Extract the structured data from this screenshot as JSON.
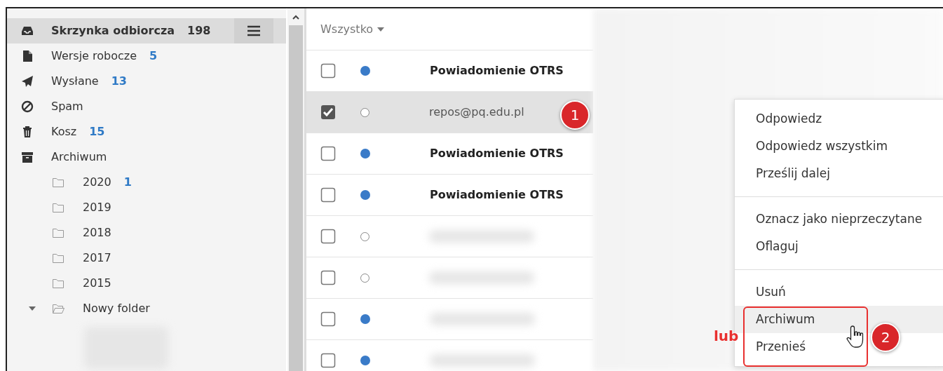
{
  "sidebar": {
    "folders": [
      {
        "kind": "inbox",
        "label": "Skrzynka odbiorcza",
        "count": "198",
        "selected": true
      },
      {
        "kind": "file",
        "label": "Wersje robocze",
        "count": "5",
        "selected": false
      },
      {
        "kind": "plane",
        "label": "Wysłane",
        "count": "13",
        "selected": false
      },
      {
        "kind": "ban",
        "label": "Spam",
        "selected": false
      },
      {
        "kind": "trash",
        "label": "Kosz",
        "count": "15",
        "selected": false
      },
      {
        "kind": "archive",
        "label": "Archiwum",
        "selected": false,
        "children": [
          {
            "kind": "folder",
            "label": "2020",
            "count": "1",
            "selected": false
          },
          {
            "kind": "folder",
            "label": "2019",
            "selected": false
          },
          {
            "kind": "folder",
            "label": "2018",
            "selected": false
          },
          {
            "kind": "folder",
            "label": "2017",
            "selected": false
          },
          {
            "kind": "folder",
            "label": "2015",
            "selected": false
          },
          {
            "kind": "folder-open",
            "label": "Nowy folder",
            "selected": false,
            "expanded": true
          }
        ]
      }
    ]
  },
  "message_list": {
    "filter": "Wszystko",
    "rows": [
      {
        "checked": false,
        "unread": true,
        "sender": "Powiadomienie OTRS"
      },
      {
        "checked": true,
        "unread": false,
        "sender": "repos@pq.edu.pl"
      },
      {
        "checked": false,
        "unread": true,
        "sender": "Powiadomienie OTRS"
      },
      {
        "checked": false,
        "unread": true,
        "sender": "Powiadomienie OTRS"
      },
      {
        "checked": false,
        "unread": false
      },
      {
        "checked": false,
        "unread": false
      },
      {
        "checked": false,
        "unread": true
      },
      {
        "checked": false,
        "unread": true
      }
    ]
  },
  "context_menu": {
    "groups": [
      [
        {
          "label": "Odpowiedz",
          "highlighted": false
        },
        {
          "label": "Odpowiedz wszystkim",
          "highlighted": false
        },
        {
          "label": "Prześlij dalej",
          "highlighted": false
        }
      ],
      [
        {
          "label": "Oznacz jako nieprzeczytane",
          "highlighted": false
        },
        {
          "label": "Oflaguj",
          "highlighted": false
        }
      ],
      [
        {
          "label": "Usuń",
          "highlighted": false
        },
        {
          "label": "Archiwum",
          "highlighted": true
        },
        {
          "label": "Przenieś",
          "highlighted": false
        }
      ]
    ]
  },
  "annotations": {
    "markers": [
      {
        "label": "1"
      },
      {
        "label": "2"
      }
    ],
    "note": "lub"
  }
}
